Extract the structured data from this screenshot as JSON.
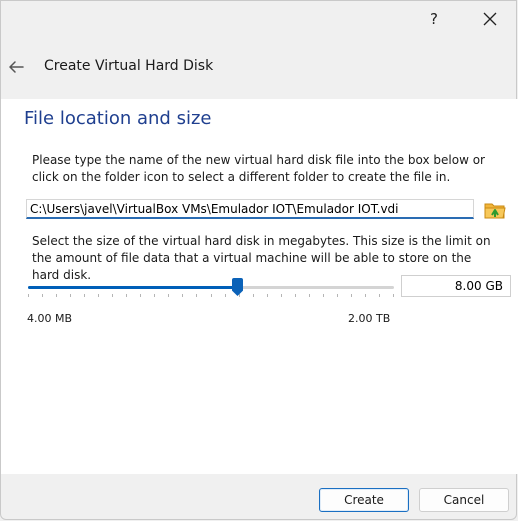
{
  "titlebar": {
    "help_label": "?",
    "close_icon": "close-icon"
  },
  "header": {
    "back_icon": "back-arrow-icon",
    "title": "Create Virtual Hard Disk"
  },
  "section": {
    "title": "File location and size"
  },
  "location": {
    "description": "Please type the name of the new virtual hard disk file into the box below or click on the folder icon to select a different folder to create the file in.",
    "path_value": "C:\\Users\\javel\\VirtualBox VMs\\Emulador IOT\\Emulador IOT.vdi",
    "folder_icon": "folder-icon"
  },
  "size": {
    "description": "Select the size of the virtual hard disk in megabytes. This size is the limit on the amount of file data that a virtual machine will be able to store on the hard disk.",
    "value": "8.00 GB",
    "slider_position": 0.57,
    "min_label": "4.00 MB",
    "max_label": "2.00 TB"
  },
  "buttons": {
    "create": "Create",
    "cancel": "Cancel"
  },
  "colors": {
    "accent": "#005fb8",
    "section_title": "#1f3f8f"
  }
}
